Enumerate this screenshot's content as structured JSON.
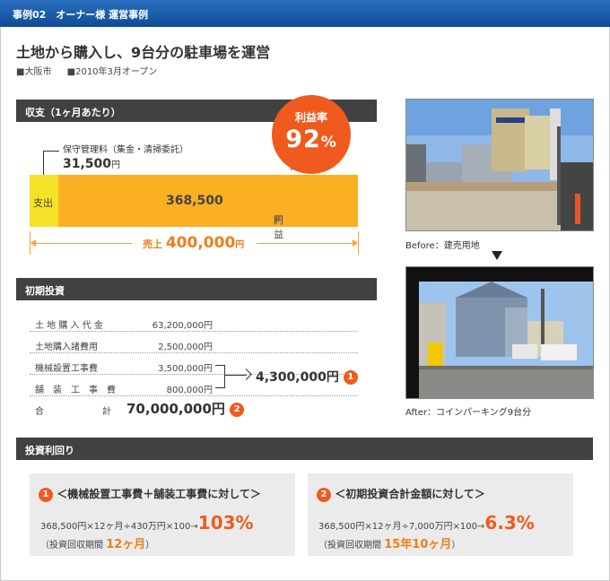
{
  "header": {
    "label": "事例02　オーナー様 運営事例"
  },
  "title": "土地から購入し、9台分の駐車場を運営",
  "meta": {
    "location": "■大阪市",
    "opened": "■2010年3月オープン"
  },
  "income": {
    "bar_label": "収支（1ヶ月あたり）",
    "profit_rate_label": "利益率",
    "profit_rate_value": "92",
    "profit_rate_unit": "%",
    "fee_label": "保守管理料（集金・清掃委託）",
    "fee_value": "31,500",
    "fee_unit": "円",
    "expense_label": "支出",
    "profit_label": "利益 ",
    "profit_value": "368,500",
    "profit_unit": "円",
    "sales_label": "売上 ",
    "sales_value": "400,000",
    "sales_unit": "円"
  },
  "initial": {
    "bar_label": "初期投資",
    "rows": [
      {
        "label": "土 地 購 入 代 金",
        "value": "63,200,000円"
      },
      {
        "label": "土地購入諸費用",
        "value": "2,500,000円"
      },
      {
        "label": "機械設置工事費",
        "value": "3,500,000円"
      },
      {
        "label": "舗　装　工　事　費",
        "value": "800,000円"
      }
    ],
    "total_label_1": "合",
    "total_label_2": "計",
    "total_value": "70,000,000円",
    "total_marker": "2",
    "subtotal_value": "4,300,000円",
    "subtotal_marker": "1"
  },
  "photos": {
    "before_caption": "Before：建売用地",
    "after_caption": "After：コインパーキング9台分"
  },
  "roi": {
    "bar_label": "投資利回り",
    "box1": {
      "marker": "1",
      "heading": "＜機械設置工事費＋舗装工事費に対して＞",
      "formula": "368,500円×12ヶ月÷430万円×100→",
      "result": "103%",
      "payback_label": "（投資回収期間 ",
      "payback_value": "12ヶ月",
      "payback_close": "）"
    },
    "box2": {
      "marker": "2",
      "heading": "＜初期投資合計金額に対して＞",
      "formula": "368,500円×12ヶ月÷7,000万円×100→",
      "result": "6.3%",
      "payback_label": "（投資回収期間 ",
      "payback_value": "15年10ヶ月",
      "payback_close": "）"
    }
  },
  "colors": {
    "header": "#0f4b95",
    "accent": "#f05a1e",
    "profit": "#fab022",
    "expense": "#f5e127",
    "bar": "#414141"
  }
}
